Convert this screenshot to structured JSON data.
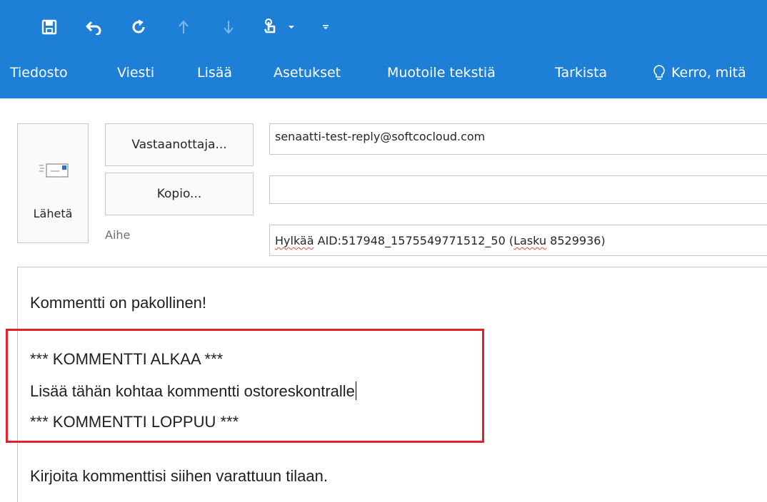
{
  "quick_access": {
    "icons": [
      "save-icon",
      "undo-icon",
      "redo-icon",
      "up-arrow-icon",
      "down-arrow-icon",
      "touch-mode-icon",
      "dropdown-arrow-icon",
      "customize-toolbar-icon"
    ]
  },
  "ribbon": {
    "tabs": [
      "Tiedosto",
      "Viesti",
      "Lisää",
      "Asetukset",
      "Muotoile tekstiä",
      "Tarkista"
    ],
    "tell_me": "Kerro, mitä",
    "background_color": "#1e7fd6"
  },
  "compose": {
    "send_label": "Lähetä",
    "to_button_label": "Vastaanottaja...",
    "cc_button_label": "Kopio...",
    "subject_label": "Aihe",
    "to_value": "senaatti-test-reply@softcocloud.com",
    "cc_value": "",
    "subject_parts": {
      "word1": "Hylkää",
      "middle": " AID:517948_1575549771512_50 (",
      "word2": "Lasku",
      "end": " 8529936)"
    }
  },
  "body": {
    "line1": "Kommentti on pakollinen!",
    "line2": "*** KOMMENTTI ALKAA ***",
    "line3": "Lisää tähän kohtaa kommentti ostoreskontralle",
    "line4": "*** KOMMENTTI LOPPUU ***",
    "line5": "Kirjoita kommenttisi siihen varattuun tilaan.",
    "highlight_color": "#e3212a"
  }
}
